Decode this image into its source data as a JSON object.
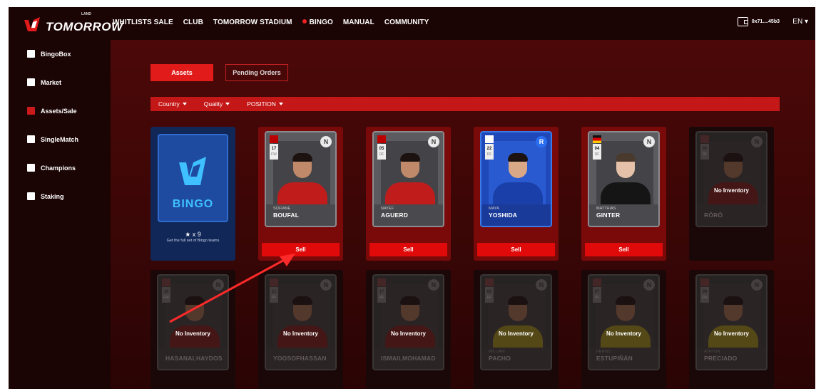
{
  "brand": {
    "name": "TOMORROW",
    "sup": "LAND"
  },
  "nav": [
    {
      "label": "WHITLISTS SALE"
    },
    {
      "label": "CLUB"
    },
    {
      "label": "TOMORROW STADIUM"
    },
    {
      "label": "BINGO"
    },
    {
      "label": "MANUAL"
    },
    {
      "label": "COMMUNITY"
    }
  ],
  "wallet": {
    "address": "0x71....45b3"
  },
  "language": {
    "label": "EN"
  },
  "sidebar": {
    "items": [
      {
        "label": "BingoBox",
        "icon": "gift-icon"
      },
      {
        "label": "Market",
        "icon": "grid-icon"
      },
      {
        "label": "Assets/Sale",
        "icon": "bag-icon",
        "active": true
      },
      {
        "label": "SingleMatch",
        "icon": "match-icon"
      },
      {
        "label": "Champions",
        "icon": "champion-icon"
      },
      {
        "label": "Staking",
        "icon": "staking-icon"
      }
    ]
  },
  "tabs": {
    "assets": "Assets",
    "pending": "Pending Orders"
  },
  "filters": {
    "country": "Country",
    "quality": "Quality",
    "position": "POSITION"
  },
  "bingo_card": {
    "word": "BINGO",
    "count": "★ x 9",
    "note": "Get the full set of Bingo teams"
  },
  "sell_label": "Sell",
  "no_inventory_label": "No Inventory",
  "cards_row1": [
    {
      "number": "17",
      "pos": "FW",
      "badge": "N",
      "first": "SOFIANE",
      "last": "BOUFAL",
      "owned": true
    },
    {
      "number": "05",
      "pos": "DF",
      "badge": "N",
      "first": "NAYEF",
      "last": "AGUERD",
      "owned": true
    },
    {
      "number": "22",
      "pos": "DF",
      "badge": "R",
      "first": "MAYA",
      "last": "YOSHIDA",
      "owned": true
    },
    {
      "number": "04",
      "pos": "DF",
      "badge": "N",
      "first": "MATTHIAS",
      "last": "GINTER",
      "owned": true
    },
    {
      "number": "02",
      "pos": "DF",
      "badge": "N",
      "first": "",
      "last": "RÔRÔ",
      "owned": false
    }
  ],
  "cards_row2": [
    {
      "number": "10",
      "pos": "FW",
      "badge": "N",
      "first": "",
      "last": "HASANALHAYDOS",
      "owned": false
    },
    {
      "number": "21",
      "pos": "DF",
      "badge": "N",
      "first": "",
      "last": "YOOSOFHASSAN",
      "owned": false
    },
    {
      "number": "17",
      "pos": "MF",
      "badge": "N",
      "first": "",
      "last": "ISMAILMOHAMAD",
      "owned": false
    },
    {
      "number": "06",
      "pos": "DF",
      "badge": "N",
      "first": "WILLIAM",
      "last": "PACHO",
      "owned": false
    },
    {
      "number": "07",
      "pos": "DF",
      "badge": "N",
      "first": "PERVIS",
      "last": "ESTUPIÑÁN",
      "owned": false
    },
    {
      "number": "09",
      "pos": "FW",
      "badge": "N",
      "first": "AYRTON",
      "last": "PRECIADO",
      "owned": false
    }
  ]
}
